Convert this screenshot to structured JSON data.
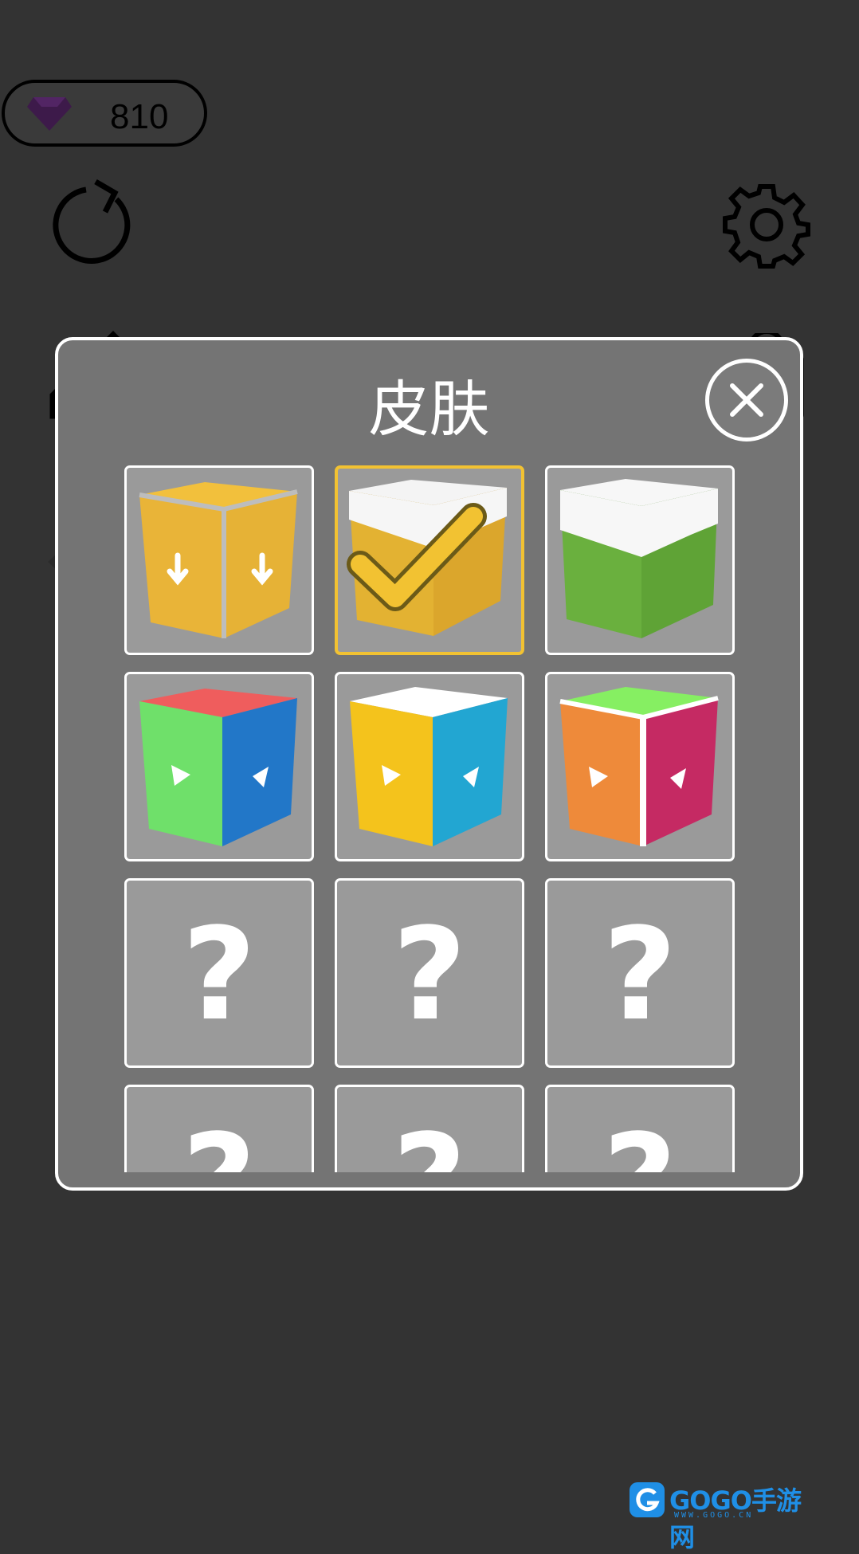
{
  "hud": {
    "gem_count": "810",
    "gem_icon": "gem-icon",
    "restart_icon": "restart-icon",
    "settings_icon": "gear-icon",
    "edit_icon": "pencil-icon",
    "back_icon": "arrow-left-icon",
    "shop_icon": "bag-icon"
  },
  "skins_panel": {
    "title": "皮肤",
    "close_icon": "close-icon",
    "selected_index": 1,
    "items": [
      {
        "kind": "yellow-arrows-cube",
        "unlocked": true
      },
      {
        "kind": "white-yellow-cube",
        "unlocked": true,
        "selected": true
      },
      {
        "kind": "white-green-cube",
        "unlocked": true
      },
      {
        "kind": "red-green-blue-cube",
        "unlocked": true
      },
      {
        "kind": "white-yellow-cyan-cube",
        "unlocked": true
      },
      {
        "kind": "green-orange-magenta-cube",
        "unlocked": true
      },
      {
        "kind": "locked",
        "label": "?"
      },
      {
        "kind": "locked",
        "label": "?"
      },
      {
        "kind": "locked",
        "label": "?"
      },
      {
        "kind": "locked",
        "label": "?"
      },
      {
        "kind": "locked",
        "label": "?"
      },
      {
        "kind": "locked",
        "label": "?"
      }
    ]
  },
  "colors": {
    "background": "#333333",
    "panel": "#747474",
    "cell": "#9a9a9a",
    "selected_border": "#f2c232",
    "gem": "#3d1a4a"
  },
  "watermark": {
    "brand": "GOGO手游网",
    "url": "WWW.GOGO.CN"
  }
}
